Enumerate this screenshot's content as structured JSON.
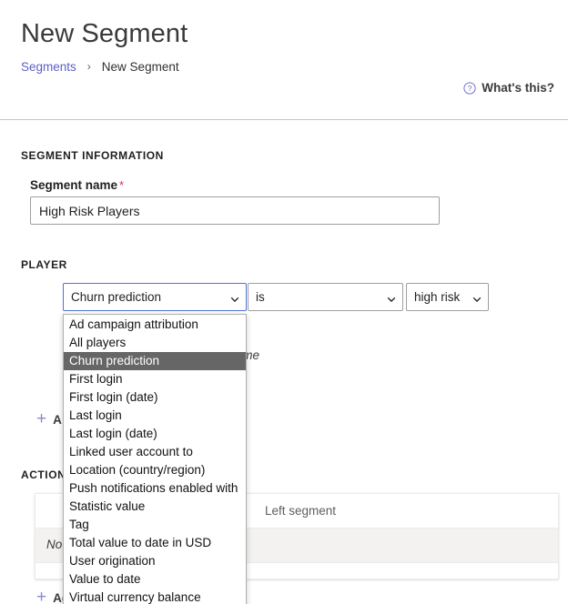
{
  "header": {
    "title": "New Segment",
    "breadcrumb": {
      "parent": "Segments",
      "separator": "›",
      "current": "New Segment"
    },
    "help": {
      "label": "What's this?",
      "icon": "help-circle-icon"
    }
  },
  "segment_information": {
    "heading": "SEGMENT INFORMATION",
    "name_field": {
      "label": "Segment name",
      "required_marker": "*",
      "value": "High Risk Players",
      "placeholder": ""
    }
  },
  "player": {
    "heading": "PLAYER",
    "condition": {
      "attribute": {
        "value": "Churn prediction",
        "focused": true,
        "expanded": true
      },
      "operator": {
        "value": "is"
      },
      "value": {
        "value": "high risk"
      }
    },
    "helper_text": "on the game",
    "add_condition_label": "A",
    "add_condition_plus": "+",
    "dropdown_options": [
      "Ad campaign attribution",
      "All players",
      "Churn prediction",
      "First login",
      "First login (date)",
      "Last login",
      "Last login (date)",
      "Linked user account to",
      "Location (country/region)",
      "Push notifications enabled with",
      "Statistic value",
      "Tag",
      "Total value to date in USD",
      "User origination",
      "Value to date",
      "Virtual currency balance"
    ],
    "dropdown_selected_index": 2
  },
  "action": {
    "heading": "ACTION",
    "table": {
      "columns": [
        "Left segment"
      ],
      "empty_message": "No c"
    },
    "add_action_label": "Add action",
    "add_action_plus": "+"
  },
  "colors": {
    "link": "#5b5fc7",
    "required": "#d6266a",
    "focus_border": "#4f72d6",
    "selected_option_bg": "#666666",
    "row_bg": "#f3f2f1"
  }
}
